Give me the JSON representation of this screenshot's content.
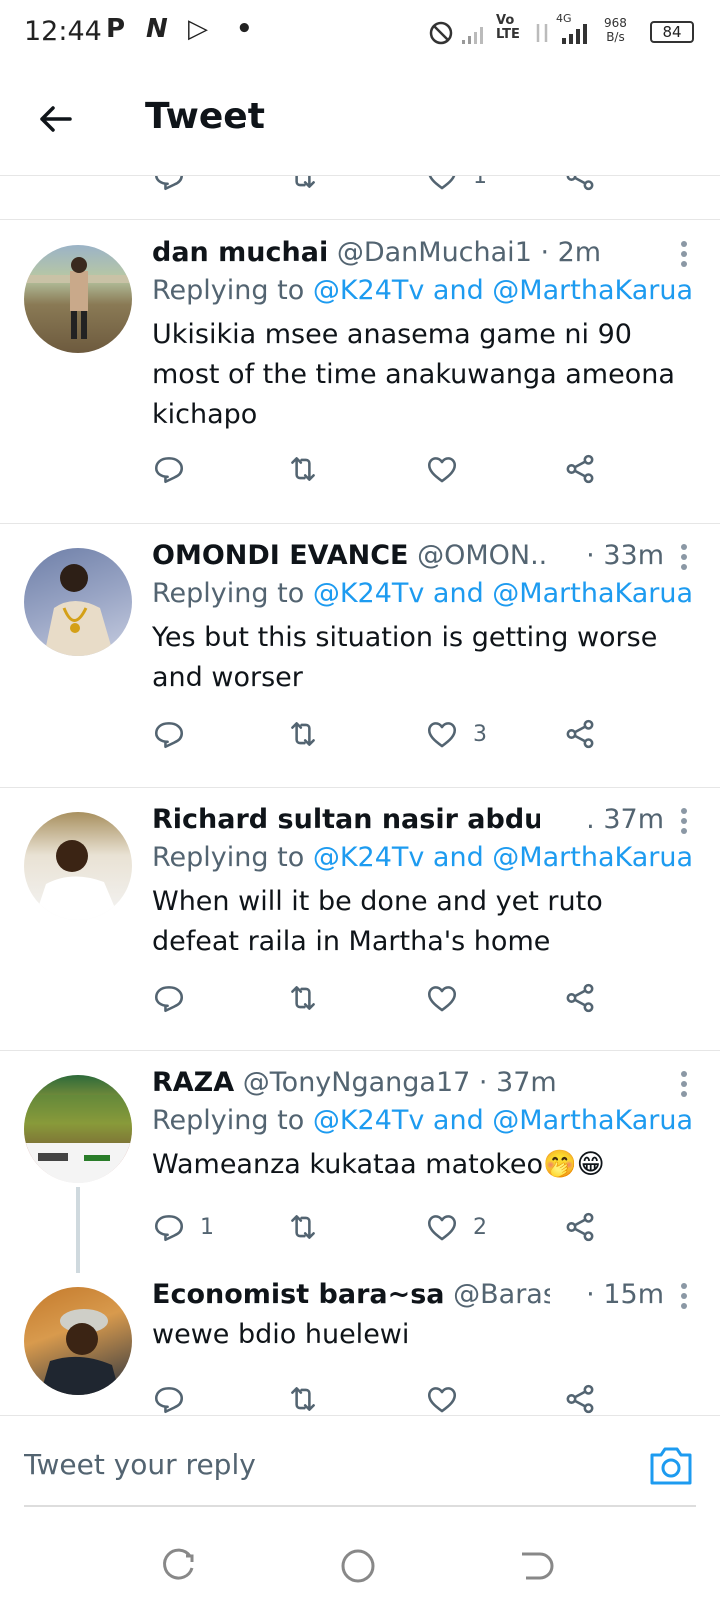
{
  "status_bar": {
    "time": "12:44",
    "icons": [
      "P",
      "N",
      "▷",
      "•"
    ],
    "network_speed": "968",
    "network_unit": "B/s",
    "battery": "84",
    "volte": "Vo",
    "lte": "LTE",
    "signal": "4G"
  },
  "header": {
    "title": "Tweet"
  },
  "tweets": [
    {
      "name": "dan muchai",
      "handle": "@DanMuchai1 · 2m",
      "time": "",
      "replying_prefix": "Replying to ",
      "replying_targets": "@K24Tv and @MarthaKarua",
      "text": "Ukisikia msee anasema game ni 90 most of the time anakuwanga ameona kichapo",
      "reply_count": "",
      "like_count": ""
    },
    {
      "name": "OMONDI EVANCE",
      "handle": "@OMON...",
      "time": "· 33m",
      "replying_prefix": "Replying to ",
      "replying_targets": "@K24Tv and @MarthaKarua",
      "text": "Yes but this situation is getting worse and worser",
      "reply_count": "",
      "like_count": "3"
    },
    {
      "name": "Richard sultan nasir abdulahi",
      "handle": "..",
      "time": ". 37m",
      "replying_prefix": "Replying to ",
      "replying_targets": "@K24Tv and @MarthaKarua",
      "text": "When will it be done and yet ruto defeat raila in Martha's home",
      "reply_count": "",
      "like_count": ""
    },
    {
      "name": "RAZA",
      "handle": "@TonyNganga17 · 37m",
      "time": "",
      "replying_prefix": "Replying to ",
      "replying_targets": "@K24Tv and @MarthaKarua",
      "text": "Wameanza kukataa matokeo🤭😁",
      "reply_count": "1",
      "like_count": "2"
    },
    {
      "name": "Economist bara~sa",
      "handle": "@Barasa...",
      "time": "· 15m",
      "text": "wewe bdio huelewi"
    }
  ],
  "top_partial": {
    "like_count": "1"
  },
  "compose": {
    "placeholder": "Tweet your reply"
  },
  "colors": {
    "link": "#1d9bf0",
    "secondary": "#536471",
    "primary": "#0f1419"
  }
}
